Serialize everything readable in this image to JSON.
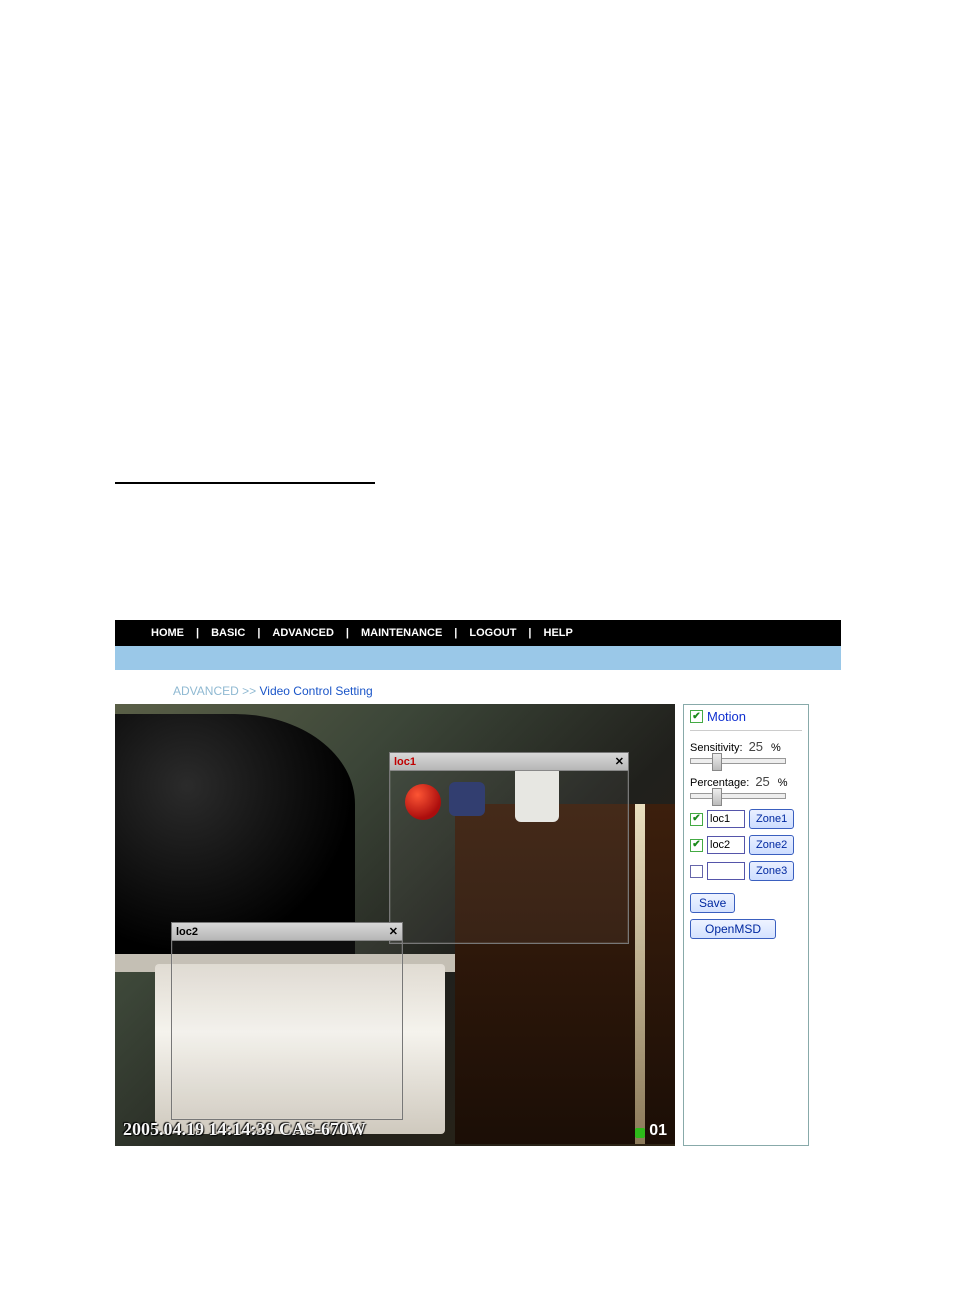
{
  "nav": {
    "items": [
      "HOME",
      "BASIC",
      "ADVANCED",
      "MAINTENANCE",
      "LOGOUT",
      "HELP"
    ]
  },
  "breadcrumb": {
    "section": "ADVANCED",
    "sep": ">>",
    "page": "Video Control Setting"
  },
  "video": {
    "overlay_text": "2005.04.19 14:14:39 CAS-670W",
    "overlay_count": "01",
    "zone1_label": "loc1",
    "zone2_label": "loc2",
    "close_glyph": "✕"
  },
  "panel": {
    "motion_label": "Motion",
    "sensitivity": {
      "label": "Sensitivity:",
      "value": "25",
      "unit": "%",
      "pos_pct": 25
    },
    "percentage": {
      "label": "Percentage:",
      "value": "25",
      "unit": "%",
      "pos_pct": 25
    },
    "zones": [
      {
        "checked": true,
        "name": "loc1",
        "btn": "Zone1"
      },
      {
        "checked": true,
        "name": "loc2",
        "btn": "Zone2"
      },
      {
        "checked": false,
        "name": "",
        "btn": "Zone3"
      }
    ],
    "save_label": "Save",
    "openmsd_label": "OpenMSD"
  }
}
